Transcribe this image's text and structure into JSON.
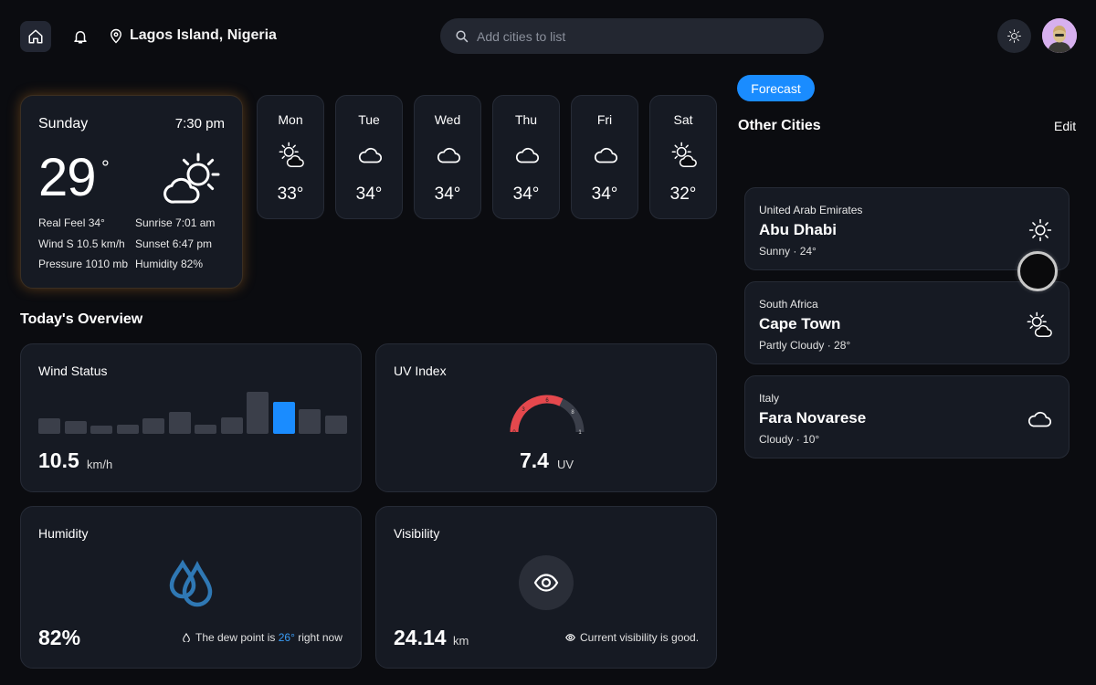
{
  "header": {
    "location": "Lagos Island, Nigeria",
    "search_placeholder": "Add cities to list"
  },
  "today": {
    "day": "Sunday",
    "time": "7:30 pm",
    "temp": "29",
    "deg": "°",
    "real_feel": "Real Feel 34°",
    "wind": "Wind S 10.5 km/h",
    "pressure": "Pressure 1010 mb",
    "sunrise": "Sunrise 7:01 am",
    "sunset": "Sunset 6:47 pm",
    "humidity": "Humidity 82%",
    "icon": "partly-cloudy-icon"
  },
  "forecast": [
    {
      "day": "Mon",
      "temp": "33°",
      "icon": "partly-cloudy-icon"
    },
    {
      "day": "Tue",
      "temp": "34°",
      "icon": "cloud-icon"
    },
    {
      "day": "Wed",
      "temp": "34°",
      "icon": "cloud-icon"
    },
    {
      "day": "Thu",
      "temp": "34°",
      "icon": "cloud-icon"
    },
    {
      "day": "Fri",
      "temp": "34°",
      "icon": "cloud-icon"
    },
    {
      "day": "Sat",
      "temp": "32°",
      "icon": "partly-cloudy-icon"
    }
  ],
  "overview": {
    "title": "Today's Overview",
    "wind": {
      "title": "Wind Status",
      "value": "10.5",
      "unit": "km/h",
      "bars": [
        0.38,
        0.3,
        0.2,
        0.22,
        0.36,
        0.52,
        0.22,
        0.4,
        1.0,
        0.76,
        0.58,
        0.44
      ],
      "active_index": 9
    },
    "uv": {
      "title": "UV Index",
      "value": "7.4",
      "unit": "UV",
      "ticks": [
        "0",
        "3",
        "6",
        "8",
        "1"
      ]
    },
    "humidity": {
      "title": "Humidity",
      "value": "82%",
      "note_prefix": "The dew point is ",
      "note_value": "26°",
      "note_suffix": " right now"
    },
    "visibility": {
      "title": "Visibility",
      "value": "24.14",
      "unit": "km",
      "note": "Current visibility is good."
    }
  },
  "right": {
    "forecast_button": "Forecast",
    "other_cities_title": "Other Cities",
    "edit_label": "Edit",
    "cities": [
      {
        "country": "United Arab Emirates",
        "name": "Abu Dhabi",
        "condition": "Sunny · 24°",
        "icon": "sun-icon"
      },
      {
        "country": "South Africa",
        "name": "Cape Town",
        "condition": "Partly Cloudy · 28°",
        "icon": "partly-cloudy-icon"
      },
      {
        "country": "Italy",
        "name": "Fara Novarese",
        "condition": "Cloudy · 10°",
        "icon": "cloud-icon"
      }
    ]
  },
  "colors": {
    "accent": "#1a8cff",
    "background": "#0b0c10",
    "card": "#161a23",
    "uv_red": "#e5484d",
    "today_glow": "#e68c28"
  }
}
